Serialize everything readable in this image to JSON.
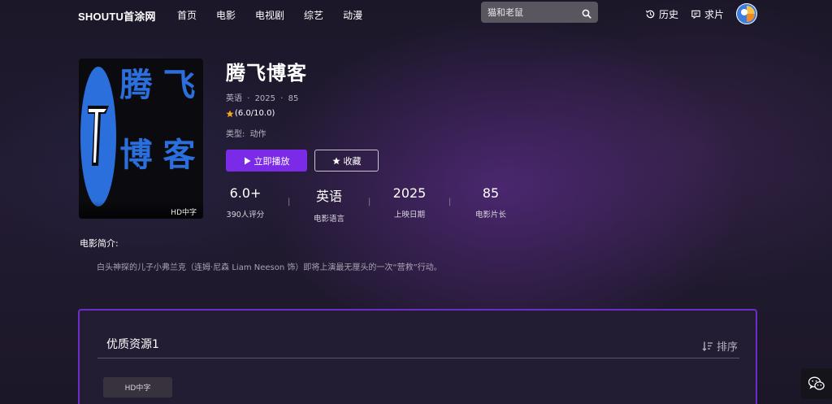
{
  "site": {
    "logo": "SHOUTU首涂网"
  },
  "nav": [
    "首页",
    "电影",
    "电视剧",
    "综艺",
    "动漫"
  ],
  "search": {
    "placeholder": "猫和老鼠"
  },
  "header_links": {
    "history": "历史",
    "request": "求片"
  },
  "poster": {
    "badge": "HD中字",
    "art_text": [
      "腾",
      "飞",
      "博",
      "客"
    ]
  },
  "movie": {
    "title": "腾飞博客",
    "language": "英语",
    "year": "2025",
    "duration": "85",
    "separator": "·",
    "rating_text": "(6.0/10.0)",
    "genre_label": "类型:",
    "genre": "动作",
    "play_label": "立即播放",
    "favorite_label": "收藏"
  },
  "stats": [
    {
      "value": "6.0+",
      "label": "390人评分"
    },
    {
      "value": "英语",
      "label": "电影语言"
    },
    {
      "value": "2025",
      "label": "上映日期"
    },
    {
      "value": "85",
      "label": "电影片长"
    }
  ],
  "intro": {
    "title": "电影简介:",
    "text": "白头神探的儿子小弗兰克（连姆·尼森 Liam Neeson 饰）即将上演最无厘头的一次“营救”行动。"
  },
  "resources": {
    "title": "优质资源1",
    "sort_label": "排序",
    "tabs": [
      "HD中字"
    ]
  },
  "colors": {
    "accent": "#7b2ae8",
    "panel_border": "#6d2cc7",
    "star": "#f5a623",
    "poster_blue": "#2a6fdc"
  }
}
